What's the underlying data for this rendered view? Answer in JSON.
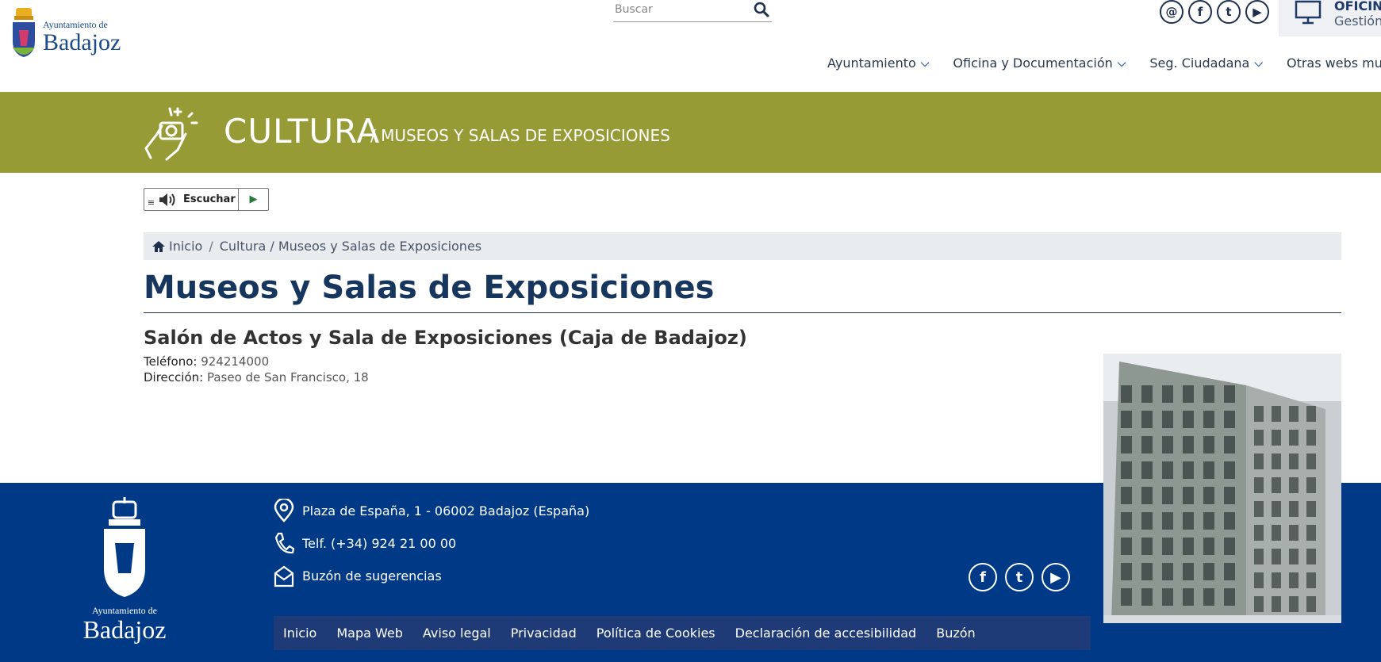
{
  "header": {
    "logo_small": "Ayuntamiento de",
    "logo_big": "Badajoz",
    "search_placeholder": "Buscar",
    "social": [
      "@",
      "f",
      "t",
      "▶"
    ],
    "oficina_title": "OFICINA",
    "oficina_sub": "Gestión",
    "nav": [
      {
        "label": "Ayuntamiento",
        "chevron": true
      },
      {
        "label": "Oficina y Documentación",
        "chevron": true
      },
      {
        "label": "Seg. Ciudadana",
        "chevron": true
      },
      {
        "label": "Otras webs municip",
        "chevron": false
      }
    ]
  },
  "banner": {
    "title": "CULTURA",
    "subtitle": "/ MUSEOS Y SALAS DE EXPOSICIONES"
  },
  "listen": {
    "label": "Escuchar"
  },
  "breadcrumb": {
    "home": "Inicio",
    "sep": "/",
    "items": [
      "Cultura / Museos y Salas de Exposiciones"
    ]
  },
  "main": {
    "title": "Museos y Salas de Exposiciones",
    "subtitle": "Salón de Actos y Sala de Exposiciones (Caja de Badajoz)",
    "phone_label": "Teléfono:",
    "phone_value": "924214000",
    "address_label": "Dirección:",
    "address_value": "Paseo de San Francisco, 18"
  },
  "footer": {
    "logo_small": "Ayuntamiento de",
    "logo_big": "Badajoz",
    "address": "Plaza de España, 1 - 06002 Badajoz (España)",
    "phone": "Telf. (+34) 924 21 00 00",
    "mailbox": "Buzón de sugerencias",
    "links": [
      "Inicio",
      "Mapa Web",
      "Aviso legal",
      "Privacidad",
      "Política de Cookies",
      "Declaración de accesibilidad",
      "Buzón"
    ]
  },
  "colors": {
    "banner": "#979b35",
    "footer": "#003a87",
    "title": "#17365d"
  }
}
